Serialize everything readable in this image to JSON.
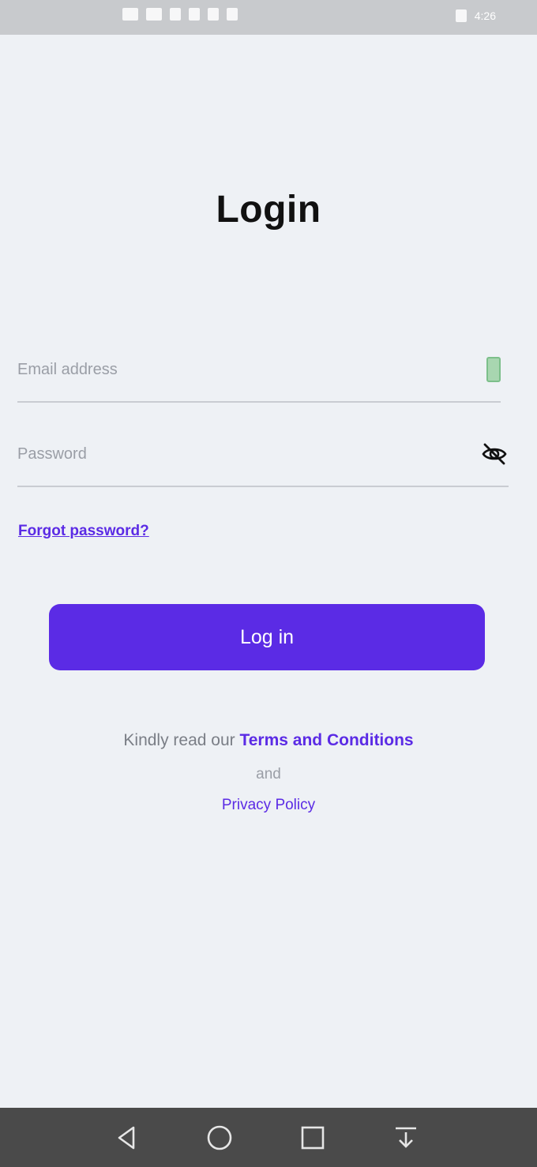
{
  "status_bar": {
    "time": "4:26",
    "icons": [
      "signal-icon",
      "signal-icon",
      "wifi-icon",
      "notification-icon",
      "alarm-icon",
      "battery-icon"
    ]
  },
  "page": {
    "title": "Login"
  },
  "form": {
    "email_placeholder": "Email address",
    "password_placeholder": "Password",
    "forgot_password": "Forgot password?",
    "login_button": "Log in"
  },
  "footer": {
    "terms_prefix": "Kindly read our ",
    "terms_link": "Terms and Conditions",
    "and": "and",
    "privacy_link": "Privacy Policy"
  },
  "nav": {
    "buttons": [
      "back-icon",
      "home-icon",
      "recents-icon",
      "download-icon"
    ]
  },
  "colors": {
    "accent": "#5B2BE5",
    "background": "#EEF1F5",
    "nav_bar": "#4A4A4A",
    "status_bar": "#C8CACD"
  }
}
